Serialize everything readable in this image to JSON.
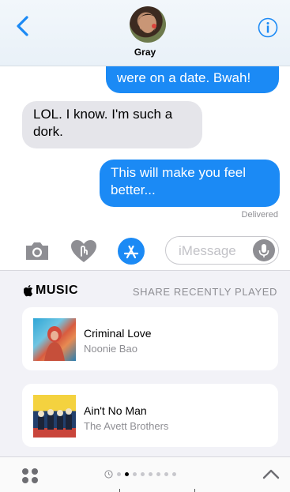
{
  "header": {
    "contact_name": "Gray"
  },
  "messages": [
    {
      "direction": "outgoing",
      "text": "were on a date. Bwah!"
    },
    {
      "direction": "incoming",
      "text": "LOL. I know. I'm such a dork."
    },
    {
      "direction": "outgoing",
      "text": "This will make you feel better..."
    }
  ],
  "status": {
    "delivered": "Delivered"
  },
  "input": {
    "placeholder": "iMessage"
  },
  "music_panel": {
    "brand": "MUSIC",
    "share_label": "SHARE RECENTLY PLAYED",
    "tracks": [
      {
        "title": "Criminal Love",
        "artist": "Noonie Bao"
      },
      {
        "title": "Ain't No Man",
        "artist": "The Avett Brothers"
      }
    ]
  },
  "pager": {
    "pages": 8,
    "active_index": 1
  },
  "colors": {
    "accent": "#1b8af5",
    "incoming_bubble": "#e5e5ea",
    "secondary_text": "#8e8e93"
  },
  "icons": [
    "chevron-left-icon",
    "info-icon",
    "camera-icon",
    "digital-touch-icon",
    "app-store-icon",
    "microphone-icon",
    "apple-icon",
    "app-drawer-icon",
    "recent-clock-icon",
    "chevron-up-icon"
  ]
}
